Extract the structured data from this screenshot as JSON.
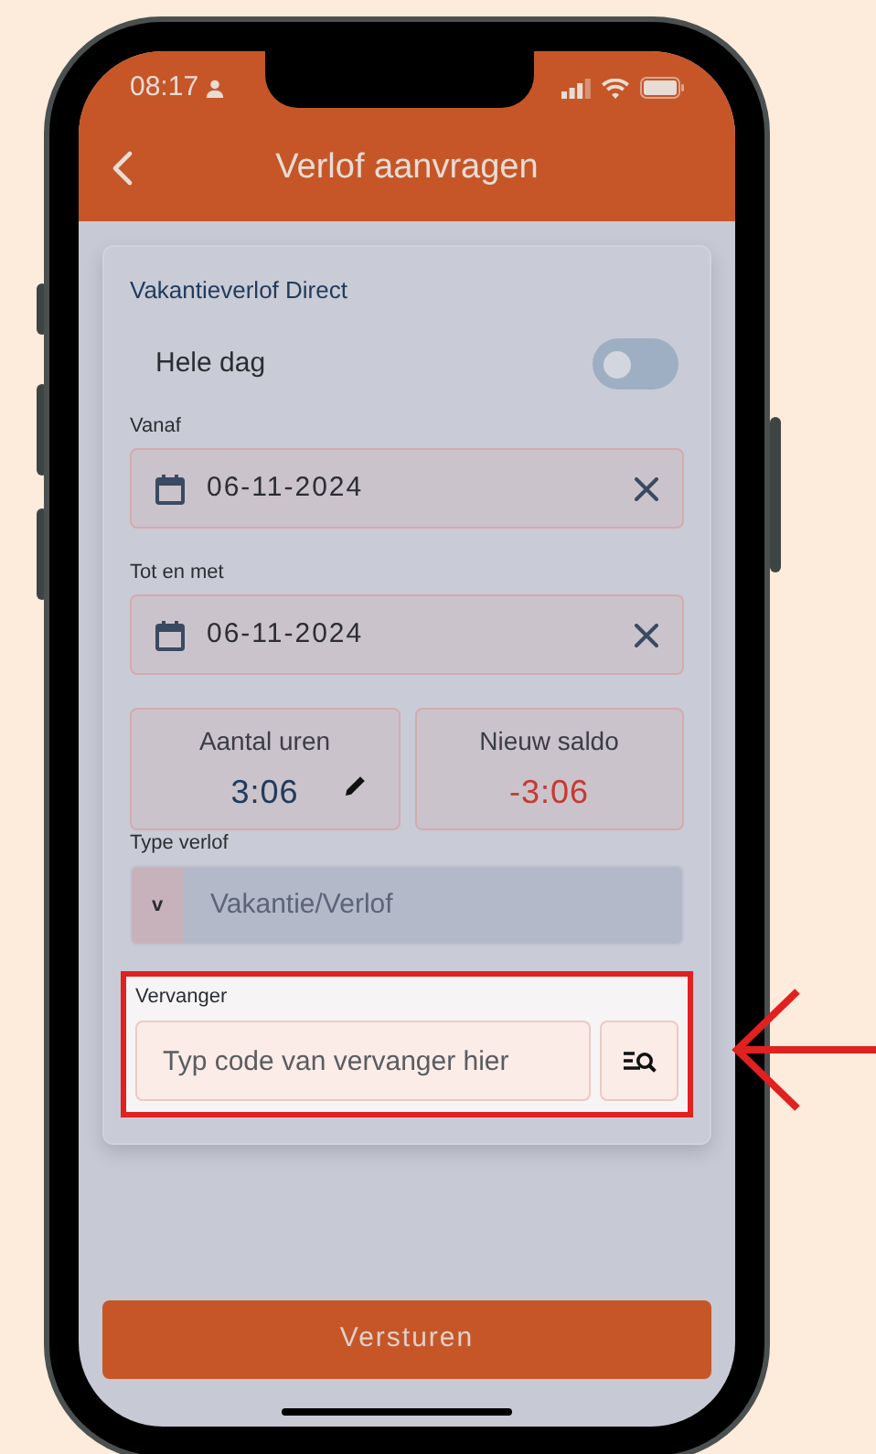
{
  "status_bar": {
    "time": "08:17"
  },
  "app_bar": {
    "title": "Verlof aanvragen"
  },
  "form": {
    "title": "Vakantieverlof Direct",
    "whole_day": {
      "label": "Hele dag",
      "on": false
    },
    "date_fields": [
      {
        "label": "Vanaf",
        "value": "06-11-2024"
      },
      {
        "label": "Tot en met",
        "value": "06-11-2024"
      }
    ],
    "summary": [
      {
        "label": "Aantal uren",
        "value": "3:06",
        "editable": true,
        "negative": false
      },
      {
        "label": "Nieuw saldo",
        "value": "-3:06",
        "editable": false,
        "negative": true
      }
    ],
    "leave_type": {
      "label": "Type verlof",
      "code": "v",
      "value": "Vakantie/Verlof"
    },
    "substitute": {
      "label": "Vervanger",
      "placeholder": "Typ code van vervanger hier",
      "highlighted": true
    }
  },
  "submit": {
    "label": "Versturen"
  }
}
